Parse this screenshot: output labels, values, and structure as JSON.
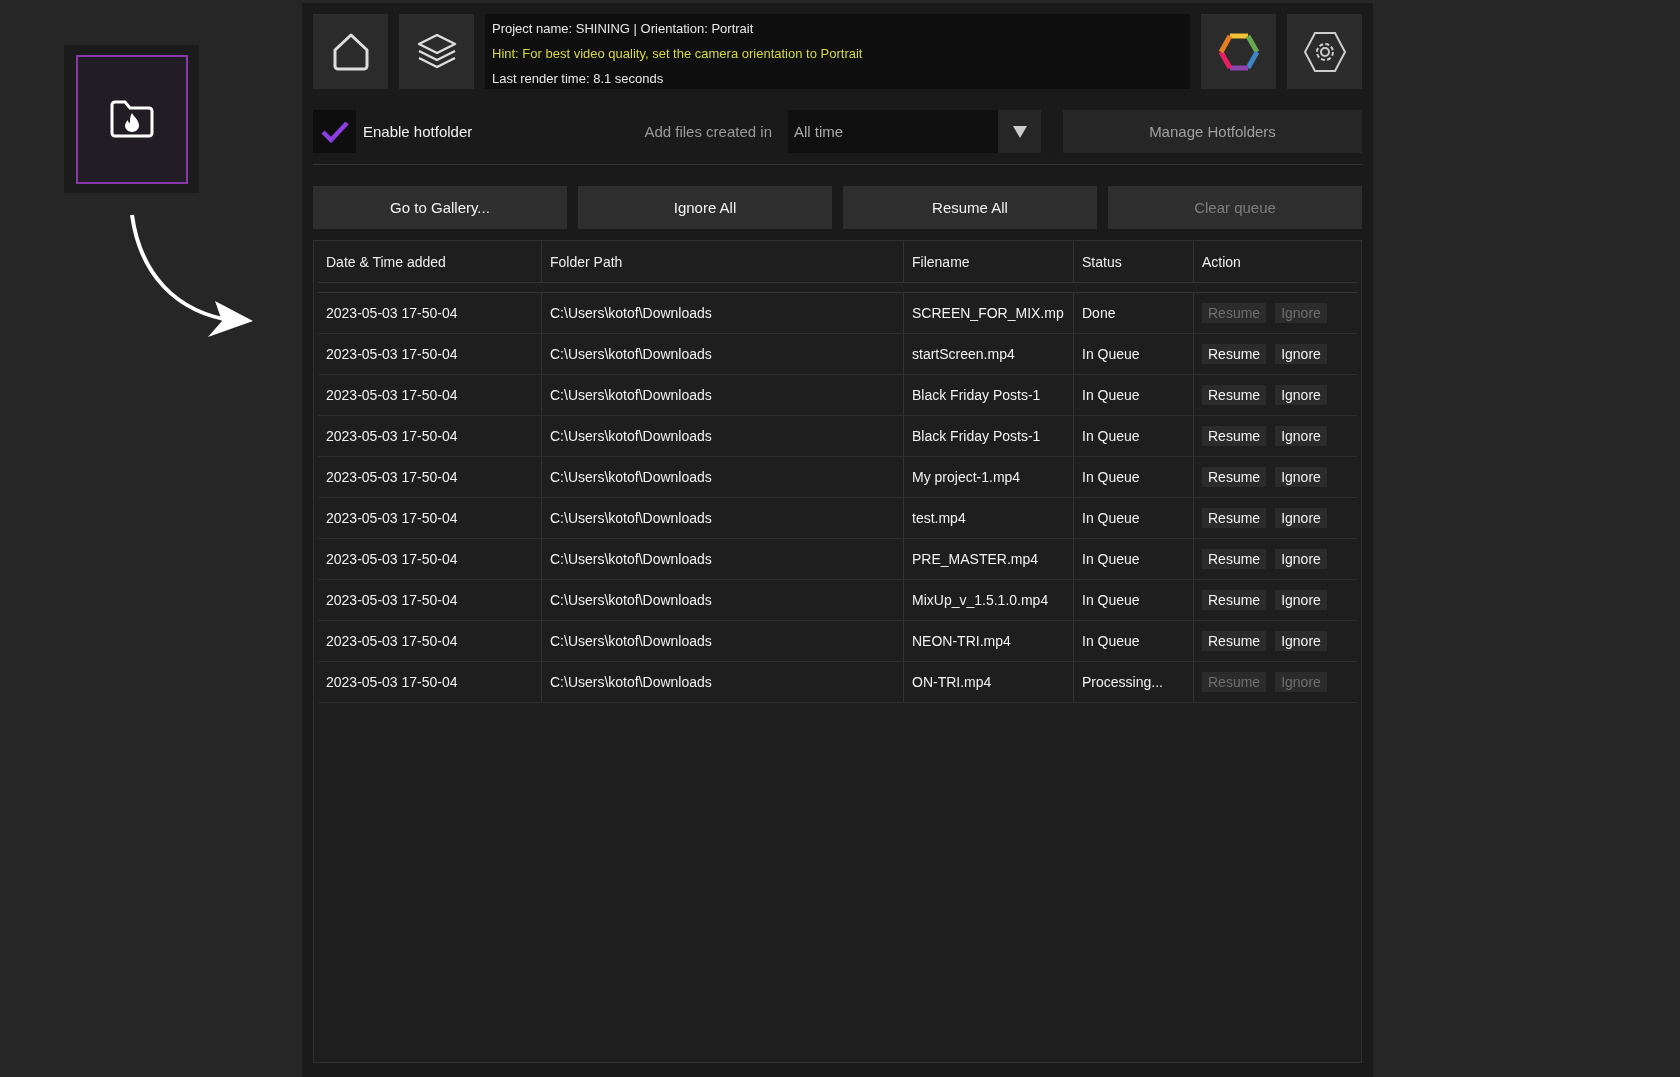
{
  "sidebar": {
    "hotfolder_tile": {
      "selected": true
    }
  },
  "header": {
    "info_lines": [
      {
        "kind": "info",
        "text": "Project name: SHINING | Orientation: Portrait"
      },
      {
        "kind": "hint",
        "text": "Hint: For best video quality, set the camera orientation to Portrait"
      },
      {
        "kind": "info",
        "text": "Last render time: 8.1 seconds"
      }
    ]
  },
  "hotfolder": {
    "enable": {
      "label": "Enable hotfolder",
      "checked": true
    },
    "filter_label": "Add files created in",
    "filter_value": "All time",
    "manage_button": {
      "label": "Manage Hotfolders",
      "disabled": true
    }
  },
  "actions": [
    {
      "label": "Go to Gallery...",
      "disabled": false
    },
    {
      "label": "Ignore All",
      "disabled": false
    },
    {
      "label": "Resume All",
      "disabled": false
    },
    {
      "label": "Clear queue",
      "disabled": true
    }
  ],
  "table": {
    "columns": [
      "Date & Time added",
      "Folder Path",
      "Filename",
      "Status",
      "Action"
    ],
    "rows": [
      {
        "date": "2023-05-03 17-50-04",
        "folder": "C:\\Users\\kotof\\Downloads",
        "filename": "SCREEN_FOR_MIX.mp",
        "status": "Done",
        "buttons": [
          {
            "label": "Resume",
            "disabled": true
          },
          {
            "label": "Ignore",
            "disabled": true
          }
        ]
      },
      {
        "date": "2023-05-03 17-50-04",
        "folder": "C:\\Users\\kotof\\Downloads",
        "filename": "startScreen.mp4",
        "status": "In Queue",
        "buttons": [
          {
            "label": "Resume",
            "disabled": false
          },
          {
            "label": "Ignore",
            "disabled": false
          }
        ]
      },
      {
        "date": "2023-05-03 17-50-04",
        "folder": "C:\\Users\\kotof\\Downloads",
        "filename": "Black Friday Posts-1",
        "status": "In Queue",
        "buttons": [
          {
            "label": "Resume",
            "disabled": false
          },
          {
            "label": "Ignore",
            "disabled": false
          }
        ]
      },
      {
        "date": "2023-05-03 17-50-04",
        "folder": "C:\\Users\\kotof\\Downloads",
        "filename": "Black Friday Posts-1",
        "status": "In Queue",
        "buttons": [
          {
            "label": "Resume",
            "disabled": false
          },
          {
            "label": "Ignore",
            "disabled": false
          }
        ]
      },
      {
        "date": "2023-05-03 17-50-04",
        "folder": "C:\\Users\\kotof\\Downloads",
        "filename": "My project-1.mp4",
        "status": "In Queue",
        "buttons": [
          {
            "label": "Resume",
            "disabled": false
          },
          {
            "label": "Ignore",
            "disabled": false
          }
        ]
      },
      {
        "date": "2023-05-03 17-50-04",
        "folder": "C:\\Users\\kotof\\Downloads",
        "filename": "test.mp4",
        "status": "In Queue",
        "buttons": [
          {
            "label": "Resume",
            "disabled": false
          },
          {
            "label": "Ignore",
            "disabled": false
          }
        ]
      },
      {
        "date": "2023-05-03 17-50-04",
        "folder": "C:\\Users\\kotof\\Downloads",
        "filename": "PRE_MASTER.mp4",
        "status": "In Queue",
        "buttons": [
          {
            "label": "Resume",
            "disabled": false
          },
          {
            "label": "Ignore",
            "disabled": false
          }
        ]
      },
      {
        "date": "2023-05-03 17-50-04",
        "folder": "C:\\Users\\kotof\\Downloads",
        "filename": "MixUp_v_1.5.1.0.mp4",
        "status": "In Queue",
        "buttons": [
          {
            "label": "Resume",
            "disabled": false
          },
          {
            "label": "Ignore",
            "disabled": false
          }
        ]
      },
      {
        "date": "2023-05-03 17-50-04",
        "folder": "C:\\Users\\kotof\\Downloads",
        "filename": "NEON-TRI.mp4",
        "status": "In Queue",
        "buttons": [
          {
            "label": "Resume",
            "disabled": false
          },
          {
            "label": "Ignore",
            "disabled": false
          }
        ]
      },
      {
        "date": "2023-05-03 17-50-04",
        "folder": "C:\\Users\\kotof\\Downloads",
        "filename": "ON-TRI.mp4",
        "status": "Processing...",
        "buttons": [
          {
            "label": "Resume",
            "disabled": true
          },
          {
            "label": "Ignore",
            "disabled": true
          }
        ]
      }
    ]
  }
}
